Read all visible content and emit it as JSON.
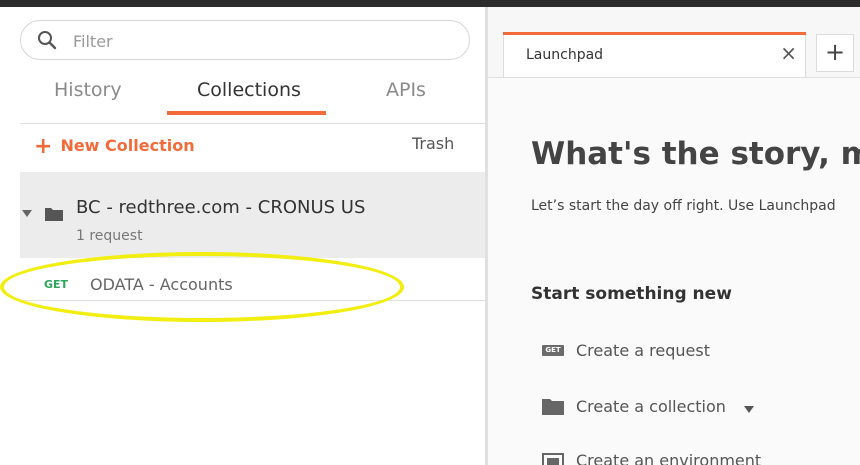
{
  "sidebar": {
    "filter": {
      "placeholder": "Filter",
      "value": "",
      "icon": "search-icon"
    },
    "tabs": [
      {
        "label": "History",
        "active": false
      },
      {
        "label": "Collections",
        "active": true
      },
      {
        "label": "APIs",
        "active": false
      }
    ],
    "toolbar": {
      "new_collection_label": "New Collection",
      "trash_label": "Trash"
    },
    "collections": [
      {
        "name": "BC - redthree.com - CRONUS US",
        "count_label": "1 request",
        "expanded": true,
        "requests": [
          {
            "method": "GET",
            "name": "ODATA - Accounts"
          }
        ]
      }
    ]
  },
  "main": {
    "tab_title": "Launchpad",
    "close_symbol": "×",
    "new_tab_symbol": "+",
    "headline": "What's the story, m",
    "subtitle": "Let’s start the day off right. Use Launchpad",
    "section_title": "Start something new",
    "actions": [
      {
        "label": "Create a request",
        "icon": "get-request-icon"
      },
      {
        "label": "Create a collection",
        "icon": "folder-icon"
      },
      {
        "label": "Create an environment",
        "icon": "environment-icon"
      }
    ]
  },
  "colors": {
    "accent": "#f26b3a",
    "get_method": "#2aa75a",
    "highlight": "#f2ee12"
  }
}
